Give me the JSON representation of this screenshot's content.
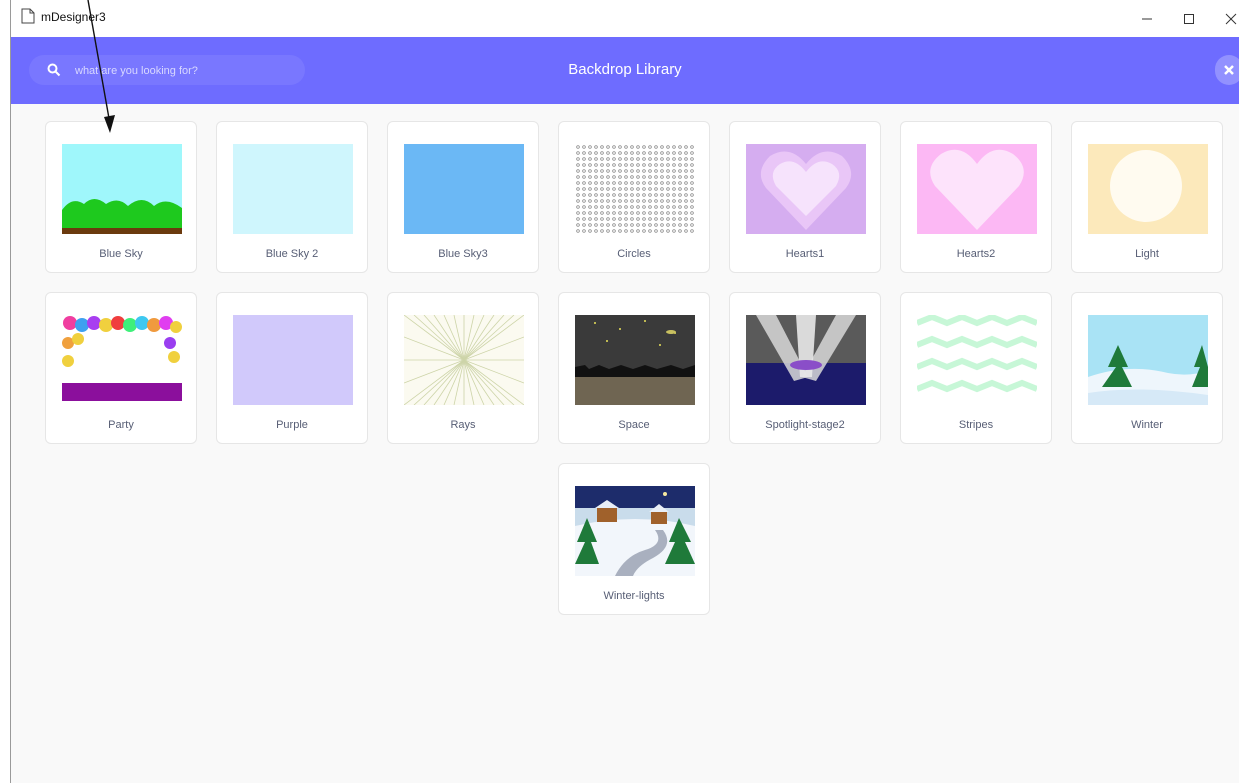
{
  "window": {
    "title": "mDesigner3"
  },
  "header": {
    "title": "Backdrop Library",
    "search_placeholder": "what are you looking for?"
  },
  "backdrops": [
    {
      "label": "Blue Sky"
    },
    {
      "label": "Blue Sky 2"
    },
    {
      "label": "Blue Sky3"
    },
    {
      "label": "Circles"
    },
    {
      "label": "Hearts1"
    },
    {
      "label": "Hearts2"
    },
    {
      "label": "Light"
    },
    {
      "label": "Party"
    },
    {
      "label": "Purple"
    },
    {
      "label": "Rays"
    },
    {
      "label": "Space"
    },
    {
      "label": "Spotlight-stage2"
    },
    {
      "label": "Stripes"
    },
    {
      "label": "Winter"
    },
    {
      "label": "Winter-lights"
    }
  ],
  "colors": {
    "header": "#6e6cff",
    "background": "#f9f9f9",
    "tile_border": "#e6e6e6"
  }
}
